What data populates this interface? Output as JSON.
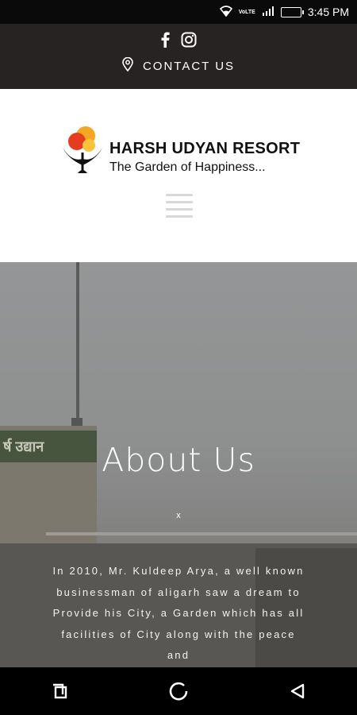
{
  "status_bar": {
    "time": "3:45 PM",
    "network": "VoLTE"
  },
  "topbar": {
    "contact_label": "CONTACT US",
    "social": [
      "facebook-icon",
      "instagram-icon"
    ]
  },
  "header": {
    "brand_name": "HARSH UDYAN RESORT",
    "tagline": "The Garden of Happiness..."
  },
  "hero": {
    "title": "About Us",
    "divider": "x",
    "body": "In 2010, Mr. Kuldeep Arya, a well known businessman of aligarh saw a dream to Provide his City, a Garden which has all facilities of City along with the peace and",
    "sign_text": "र्ष उद्यान"
  },
  "colors": {
    "topbar_bg": "#262322",
    "status_bg": "#0a0a0a",
    "nav_bg": "#000000"
  }
}
